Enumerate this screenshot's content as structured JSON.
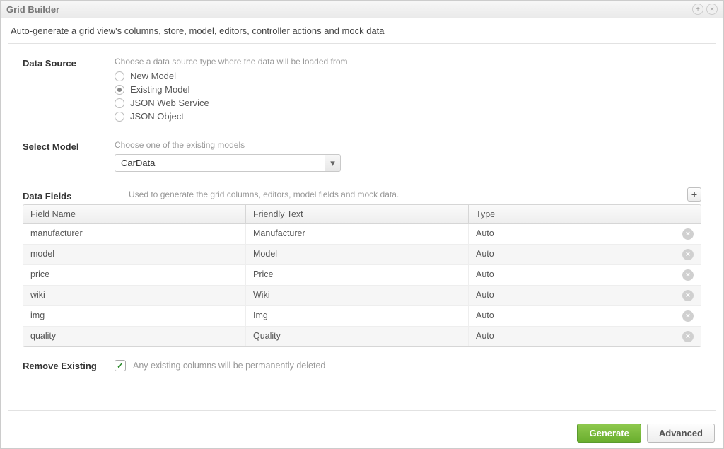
{
  "header": {
    "title": "Grid Builder"
  },
  "subtitle": "Auto-generate a grid view's columns, store, model, editors, controller actions and mock data",
  "data_source": {
    "label": "Data Source",
    "hint": "Choose a data source type where the data will be loaded from",
    "options": [
      "New Model",
      "Existing Model",
      "JSON Web Service",
      "JSON Object"
    ],
    "selected_index": 1
  },
  "select_model": {
    "label": "Select Model",
    "hint": "Choose one of the existing models",
    "value": "CarData"
  },
  "data_fields": {
    "label": "Data Fields",
    "hint": "Used to generate the grid columns, editors, model fields and mock data.",
    "columns": {
      "field_name": "Field Name",
      "friendly": "Friendly Text",
      "type": "Type"
    },
    "rows": [
      {
        "field": "manufacturer",
        "friendly": "Manufacturer",
        "type": "Auto"
      },
      {
        "field": "model",
        "friendly": "Model",
        "type": "Auto"
      },
      {
        "field": "price",
        "friendly": "Price",
        "type": "Auto"
      },
      {
        "field": "wiki",
        "friendly": "Wiki",
        "type": "Auto"
      },
      {
        "field": "img",
        "friendly": "Img",
        "type": "Auto"
      },
      {
        "field": "quality",
        "friendly": "Quality",
        "type": "Auto"
      }
    ]
  },
  "remove_existing": {
    "label": "Remove Existing",
    "hint": "Any existing columns will be permanently deleted",
    "checked": true
  },
  "buttons": {
    "generate": "Generate",
    "advanced": "Advanced"
  }
}
